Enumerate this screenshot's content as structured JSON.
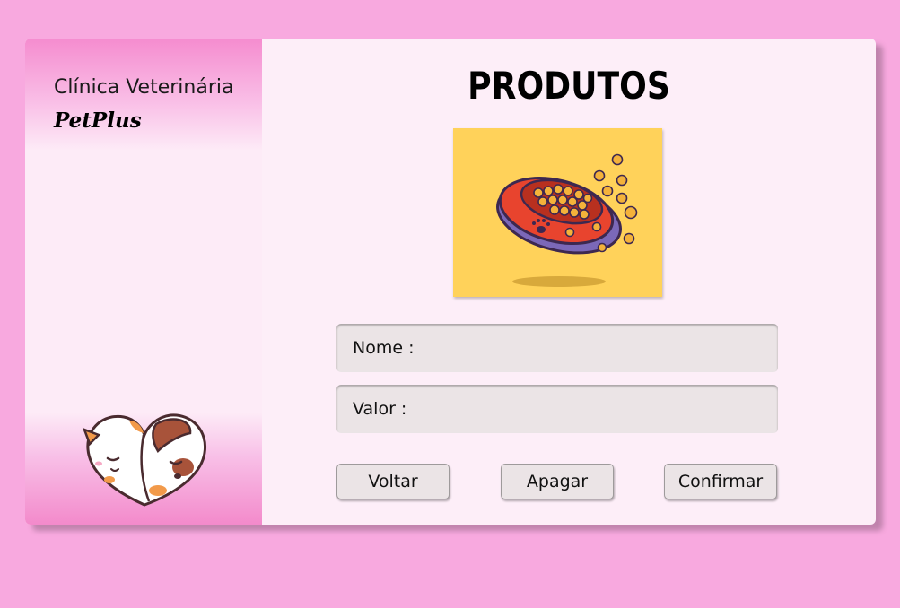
{
  "sidebar": {
    "clinic_name": "Clínica Veterinária",
    "brand": "PetPlus",
    "logo_icon": "cat-dog-heart-icon"
  },
  "main": {
    "title": "PRODUTOS",
    "image_icon": "pet-food-bowl-icon",
    "fields": {
      "nome_label": "Nome :",
      "nome_value": "",
      "valor_label": "Valor :",
      "valor_value": ""
    },
    "buttons": {
      "voltar": "Voltar",
      "apagar": "Apagar",
      "confirmar": "Confirmar"
    }
  },
  "colors": {
    "background": "#f8a9df",
    "panel": "#fdeef8",
    "sidebar_gradient": "#f58ccf",
    "image_bg": "#ffd25a",
    "field_bg": "#ebe4e6"
  }
}
